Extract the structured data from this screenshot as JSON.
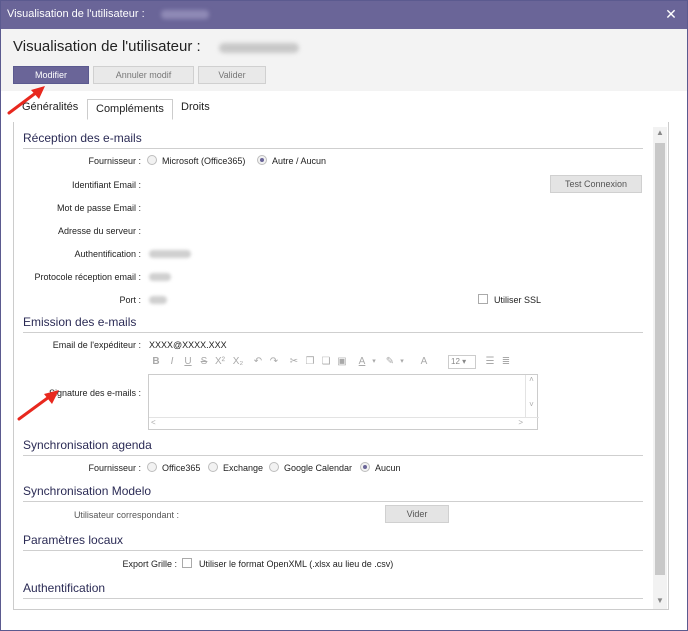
{
  "window": {
    "title": "Visualisation de l'utilisateur :",
    "close_icon": "close-icon"
  },
  "header": {
    "title": "Visualisation de l'utilisateur :",
    "buttons": {
      "modify": "Modifier",
      "cancel": "Annuler modif",
      "validate": "Valider"
    }
  },
  "tabs": [
    "Généralités",
    "Compléments",
    "Droits"
  ],
  "active_tab": "Compléments",
  "email_reception": {
    "title": "Réception des e-mails",
    "provider_label": "Fournisseur :",
    "provider_options": [
      "Microsoft (Office365)",
      "Autre / Aucun"
    ],
    "provider_selected": "Autre / Aucun",
    "email_id_label": "Identifiant Email :",
    "test_button": "Test Connexion",
    "password_label": "Mot de passe Email :",
    "server_label": "Adresse du serveur :",
    "auth_label": "Authentification :",
    "protocol_label": "Protocole réception email :",
    "port_label": "Port :",
    "ssl_label": "Utiliser SSL"
  },
  "email_sending": {
    "title": "Emission des e-mails",
    "sender_label": "Email de l'expéditeur :",
    "sender_value": "XXXX@XXXX.XXX",
    "font_size": "12",
    "signature_label": "Signature des e-mails :"
  },
  "calendar_sync": {
    "title": "Synchronisation agenda",
    "provider_label": "Fournisseur :",
    "options": [
      "Office365",
      "Exchange",
      "Google Calendar",
      "Aucun"
    ],
    "selected": "Aucun"
  },
  "modelo_sync": {
    "title": "Synchronisation Modelo",
    "user_label": "Utilisateur correspondant :",
    "clear_button": "Vider"
  },
  "local_settings": {
    "title": "Paramètres locaux",
    "export_label": "Export Grille :",
    "openxml_label": "Utiliser le format OpenXML (.xlsx au lieu de .csv)"
  },
  "authentication": {
    "title": "Authentification"
  },
  "colors": {
    "accent": "#6a6598",
    "annotation_arrow": "#e8281e"
  }
}
